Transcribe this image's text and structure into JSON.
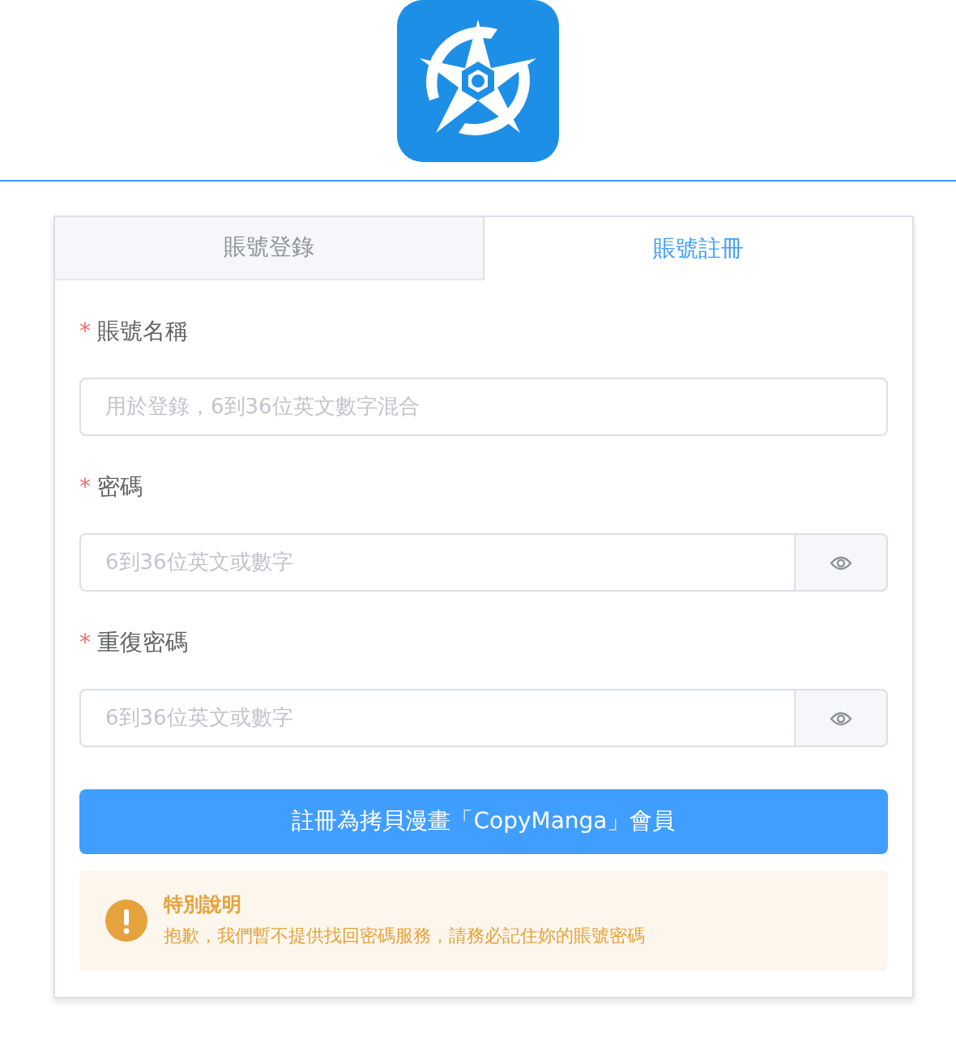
{
  "tabs": [
    {
      "label": "賬號登錄",
      "selected": false
    },
    {
      "label": "賬號註冊",
      "selected": true
    }
  ],
  "fields": [
    {
      "kind": "text",
      "label": "賬號名稱",
      "required_mark": "*",
      "placeholder": "用於登錄，6到36位英文數字混合"
    },
    {
      "kind": "password",
      "label": "密碼",
      "required_mark": "*",
      "placeholder": "6到36位英文或數字"
    },
    {
      "kind": "password",
      "label": "重復密碼",
      "required_mark": "*",
      "placeholder": "6到36位英文或數字"
    }
  ],
  "submit_button": "註冊為拷貝漫畫「CopyManga」會員",
  "notice": {
    "title": "特別說明",
    "text": "抱歉，我們暫不提供找回密碼服務，請務必記住妳的賬號密碼"
  }
}
